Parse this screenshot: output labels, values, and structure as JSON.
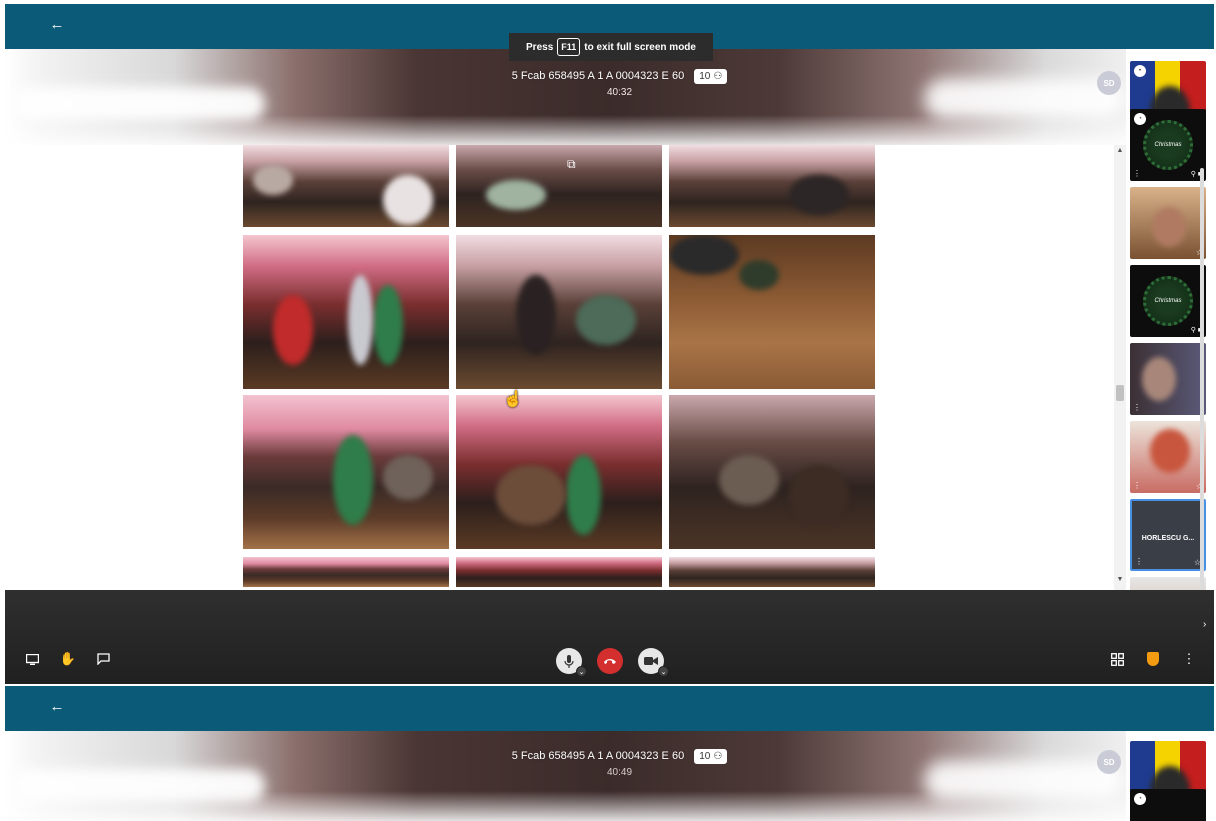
{
  "frame1": {
    "meeting_title": "5 Fcab 658495 A 1 A 0004323 E 60",
    "participant_count": "10",
    "timer": "40:32",
    "toast": {
      "press": "Press",
      "key": "F11",
      "message": "to exit full screen mode"
    },
    "self_avatar_initials": "SD",
    "filmstrip": {
      "active_tile_name": "HORLESCU G..."
    }
  },
  "frame2": {
    "meeting_title": "5 Fcab 658495 A 1 A 0004323 E 60",
    "participant_count": "10",
    "timer": "40:49",
    "self_avatar_initials": "SD"
  },
  "icons": {
    "back": "arrow-left-icon",
    "screen_share": "monitor-icon",
    "raise_hand": "hand-icon",
    "chat": "chat-bubble-icon",
    "mic": "microphone-icon",
    "hangup": "phone-hangup-icon",
    "camera": "video-camera-icon",
    "tile_view": "grid-icon",
    "security": "shield-icon",
    "more": "more-vertical-icon"
  },
  "colors": {
    "topbar": "#0b5a78",
    "hangup": "#d32f2f",
    "security_shield": "#f39c12",
    "controlbar": "#262626"
  }
}
